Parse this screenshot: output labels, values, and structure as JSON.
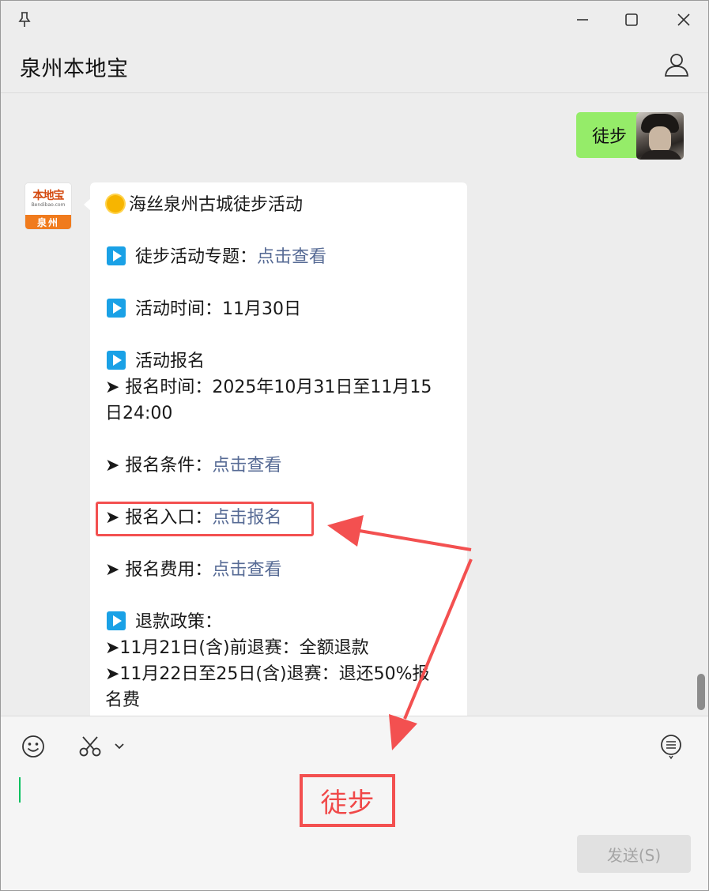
{
  "window": {
    "title": "泉州本地宝"
  },
  "chat": {
    "outgoing_text": "徒步",
    "bot_logo": {
      "name": "本地宝",
      "sub": "Bendibao.com",
      "city": "泉州"
    },
    "message": {
      "title": "海丝泉州古城徒步活动",
      "topic_label": "徒步活动专题：",
      "topic_link": "点击查看",
      "time_label": "活动时间：11月30日",
      "signup_heading": "活动报名",
      "signup_time_1": "➤ 报名时间：2025年10月31日至11月15",
      "signup_time_2": "日24:00",
      "conditions_label": "➤ 报名条件：",
      "conditions_link": "点击查看",
      "entry_label": "➤ 报名入口：",
      "entry_link": "点击报名",
      "fee_label": "➤ 报名费用：",
      "fee_link": "点击查看",
      "refund_heading": "退款政策：",
      "refund_1": "➤11月21日(含)前退赛：全额退款",
      "refund_2": "➤11月22日至25日(含)退赛：退还50%报",
      "refund_3": "名费"
    }
  },
  "composer": {
    "send_label": "发送(S)"
  },
  "annotation": {
    "label": "徒步",
    "color": "#f35050"
  },
  "colors": {
    "outgoing_bubble": "#95ec69",
    "link": "#576b95",
    "accent_green": "#07c160"
  }
}
